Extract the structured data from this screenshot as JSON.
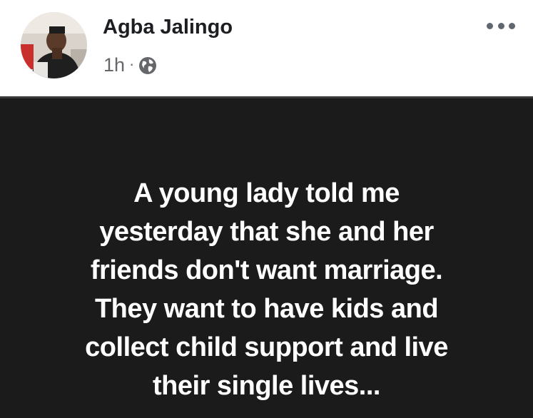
{
  "post": {
    "author": "Agba Jalingo",
    "time": "1h",
    "separator": "·",
    "privacy_icon": "globe-icon",
    "menu_icon": "more-options-icon",
    "body_text": "A young lady told me\nyesterday that she and her\nfriends don't want marriage.\nThey want to have kids and\ncollect child support and live\ntheir single lives..."
  },
  "colors": {
    "card_background": "#1b1b1b",
    "card_text": "#ffffff",
    "author_text": "#1c1e21",
    "meta_text": "#65676b"
  }
}
